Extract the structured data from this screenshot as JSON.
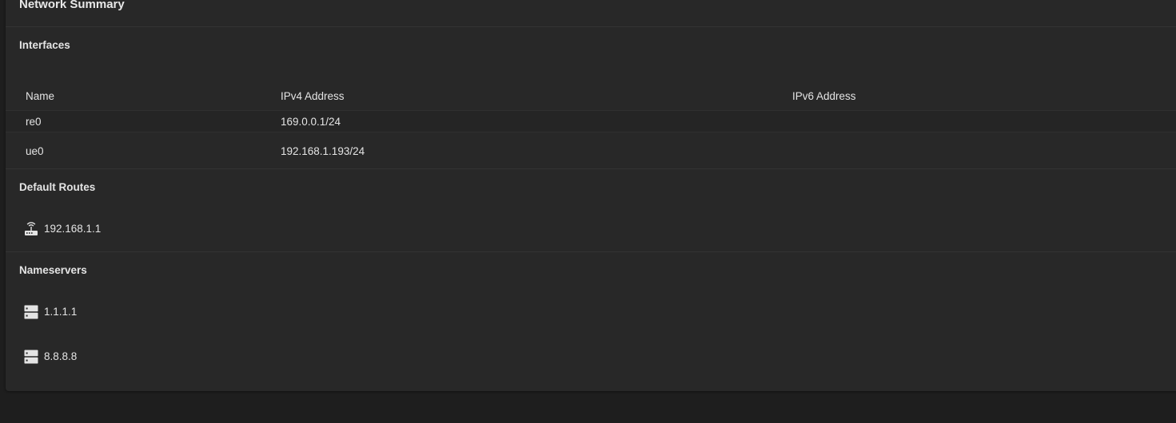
{
  "card": {
    "title": "Network Summary"
  },
  "interfaces": {
    "title": "Interfaces",
    "columns": [
      "Name",
      "IPv4 Address",
      "IPv6 Address"
    ],
    "rows": [
      {
        "name": "re0",
        "ipv4": "169.0.0.1/24",
        "ipv6": ""
      },
      {
        "name": "ue0",
        "ipv4": "192.168.1.193/24",
        "ipv6": ""
      }
    ]
  },
  "default_routes": {
    "title": "Default Routes",
    "items": [
      {
        "icon": "router-icon",
        "address": "192.168.1.1"
      }
    ]
  },
  "nameservers": {
    "title": "Nameservers",
    "items": [
      {
        "icon": "server-icon",
        "address": "1.1.1.1"
      },
      {
        "icon": "server-icon",
        "address": "8.8.8.8"
      }
    ]
  }
}
